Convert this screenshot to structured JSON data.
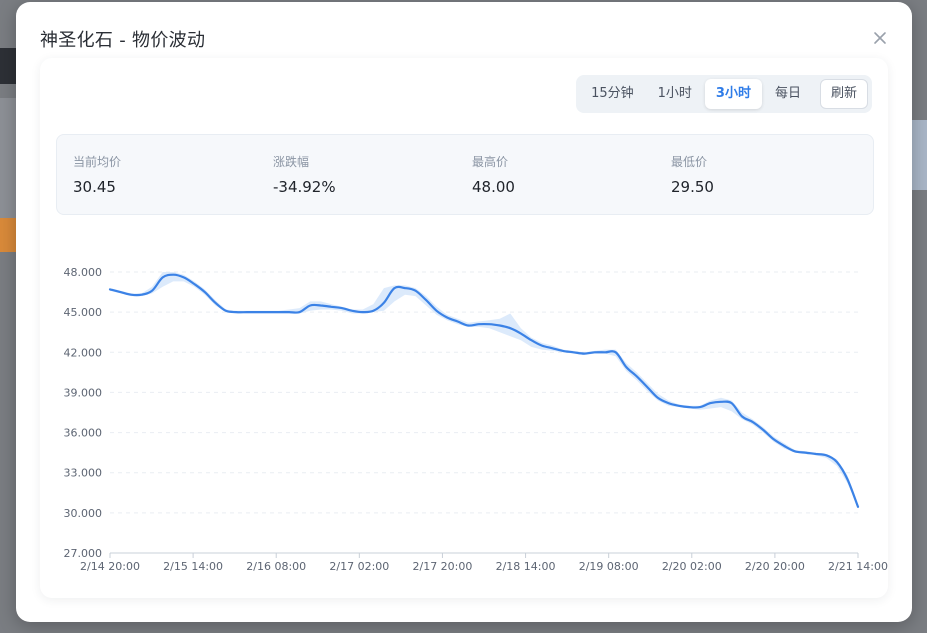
{
  "dialog": {
    "title": "神圣化石 - 物价波动"
  },
  "range_options": [
    {
      "label": "15分钟",
      "active": false
    },
    {
      "label": "1小时",
      "active": false
    },
    {
      "label": "3小时",
      "active": true
    },
    {
      "label": "每日",
      "active": false
    }
  ],
  "refresh_label": "刷新",
  "stats": [
    {
      "label": "当前均价",
      "value": "30.45"
    },
    {
      "label": "涨跌幅",
      "value": "-34.92%"
    },
    {
      "label": "最高价",
      "value": "48.00"
    },
    {
      "label": "最低价",
      "value": "29.50"
    }
  ],
  "colors": {
    "accent": "#3b82e6",
    "band": "#d6e6fa"
  },
  "chart_data": {
    "type": "line",
    "ylim": [
      27,
      48
    ],
    "y_ticks": [
      "48.000",
      "45.000",
      "42.000",
      "39.000",
      "36.000",
      "33.000",
      "30.000",
      "27.000"
    ],
    "x_ticks": [
      "2/14 20:00",
      "2/15 14:00",
      "2/16 08:00",
      "2/17 02:00",
      "2/17 20:00",
      "2/18 14:00",
      "2/19 08:00",
      "2/20 02:00",
      "2/20 20:00",
      "2/21 14:00"
    ],
    "grid": true,
    "series": [
      {
        "values": [
          46.7,
          46.5,
          46.3,
          46.3,
          46.6,
          47.6,
          47.8,
          47.6,
          47.1,
          46.5,
          45.7,
          45.1,
          45.0,
          45.0,
          45.0,
          45.0,
          45.0,
          45.0,
          45.0,
          45.5,
          45.5,
          45.4,
          45.3,
          45.1,
          45.0,
          45.1,
          45.7,
          46.8,
          46.8,
          46.6,
          45.9,
          45.1,
          44.6,
          44.3,
          44.0,
          44.1,
          44.1,
          44.0,
          43.8,
          43.4,
          42.9,
          42.5,
          42.3,
          42.1,
          42.0,
          41.9,
          42.0,
          42.0,
          42.0,
          40.9,
          40.2,
          39.4,
          38.6,
          38.2,
          38.0,
          37.9,
          37.9,
          38.2,
          38.3,
          38.2,
          37.2,
          36.8,
          36.2,
          35.5,
          35.0,
          34.6,
          34.5,
          34.4,
          34.3,
          33.8,
          32.5,
          30.45
        ],
        "lows": [
          46.6,
          46.4,
          46.2,
          46.2,
          46.4,
          46.9,
          47.3,
          47.3,
          46.9,
          46.3,
          45.5,
          45.0,
          44.9,
          44.9,
          44.9,
          44.9,
          44.9,
          44.9,
          44.9,
          45.1,
          45.2,
          45.2,
          45.1,
          44.9,
          44.9,
          45.0,
          45.1,
          45.8,
          46.3,
          46.2,
          45.5,
          44.8,
          44.4,
          44.1,
          43.9,
          43.9,
          43.8,
          43.5,
          43.2,
          42.9,
          42.4,
          42.2,
          42.1,
          42.0,
          41.9,
          41.8,
          41.9,
          41.9,
          41.7,
          40.6,
          39.9,
          39.1,
          38.4,
          38.0,
          37.9,
          37.8,
          37.7,
          37.8,
          37.9,
          37.6,
          37.0,
          36.6,
          36.0,
          35.3,
          34.8,
          34.5,
          34.4,
          34.3,
          34.1,
          33.5,
          32.2,
          30.4
        ],
        "highs": [
          46.8,
          46.6,
          46.4,
          46.4,
          46.9,
          48.0,
          48.0,
          47.8,
          47.3,
          46.7,
          45.9,
          45.2,
          45.1,
          45.1,
          45.1,
          45.1,
          45.1,
          45.2,
          45.3,
          45.8,
          45.8,
          45.6,
          45.4,
          45.2,
          45.2,
          45.6,
          46.8,
          47.0,
          47.0,
          46.8,
          46.2,
          45.4,
          44.8,
          44.5,
          44.2,
          44.3,
          44.4,
          44.5,
          44.9,
          43.8,
          43.1,
          42.7,
          42.5,
          42.2,
          42.1,
          42.0,
          42.1,
          42.2,
          42.2,
          41.2,
          40.5,
          39.7,
          38.9,
          38.4,
          38.1,
          38.0,
          38.0,
          38.4,
          38.6,
          38.4,
          37.5,
          37.0,
          36.4,
          35.7,
          35.2,
          34.7,
          34.6,
          34.5,
          34.4,
          34.0,
          32.8,
          30.6
        ]
      }
    ]
  }
}
